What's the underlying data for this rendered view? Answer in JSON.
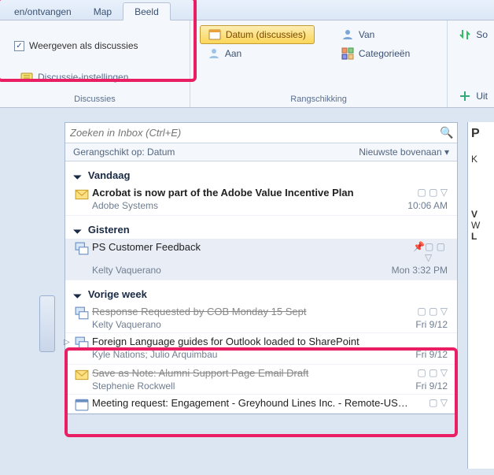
{
  "ribbon": {
    "tabs": {
      "zenden": "en/ontvangen",
      "map": "Map",
      "beeld": "Beeld"
    },
    "discussies": {
      "show_as_threads": "Weergeven als discussies",
      "settings": "Discussie-instellingen",
      "group_label": "Discussies"
    },
    "rangschikking": {
      "datum": "Datum (discussies)",
      "aan": "Aan",
      "van": "Van",
      "categorieen": "Categorieën",
      "group_label": "Rangschikking"
    },
    "right": {
      "so": "So",
      "uit": "Uit"
    }
  },
  "search": {
    "placeholder": "Zoeken in Inbox (Ctrl+E)"
  },
  "sortheader": {
    "left": "Gerangschikt op: Datum",
    "right": "Nieuwste bovenaan"
  },
  "groups": {
    "today": "Vandaag",
    "yesterday": "Gisteren",
    "lastweek": "Vorige week"
  },
  "messages": {
    "m1": {
      "title": "Acrobat is now part of the Adobe Value Incentive Plan",
      "from": "Adobe Systems",
      "time": "10:06 AM"
    },
    "m2": {
      "title": "PS Customer Feedback",
      "from": "Kelty Vaquerano",
      "time": "Mon 3:32 PM"
    },
    "m3": {
      "title": "Response Requested by COB Monday 15 Sept",
      "from": "Kelty Vaquerano",
      "time": "Fri 9/12"
    },
    "m4": {
      "title": "Foreign Language guides for Outlook loaded to SharePoint",
      "from": "Kyle Nations;  Julio Arquimbau",
      "time": "Fri 9/12"
    },
    "m5": {
      "title": "Save as Note: Alumni Support Page Email Draft",
      "from": "Stephenie Rockwell",
      "time": "Fri 9/12"
    },
    "m6": {
      "title": "Meeting request: Engagement - Greyhound Lines Inc. - Remote-US…",
      "from": "",
      "time": ""
    }
  }
}
